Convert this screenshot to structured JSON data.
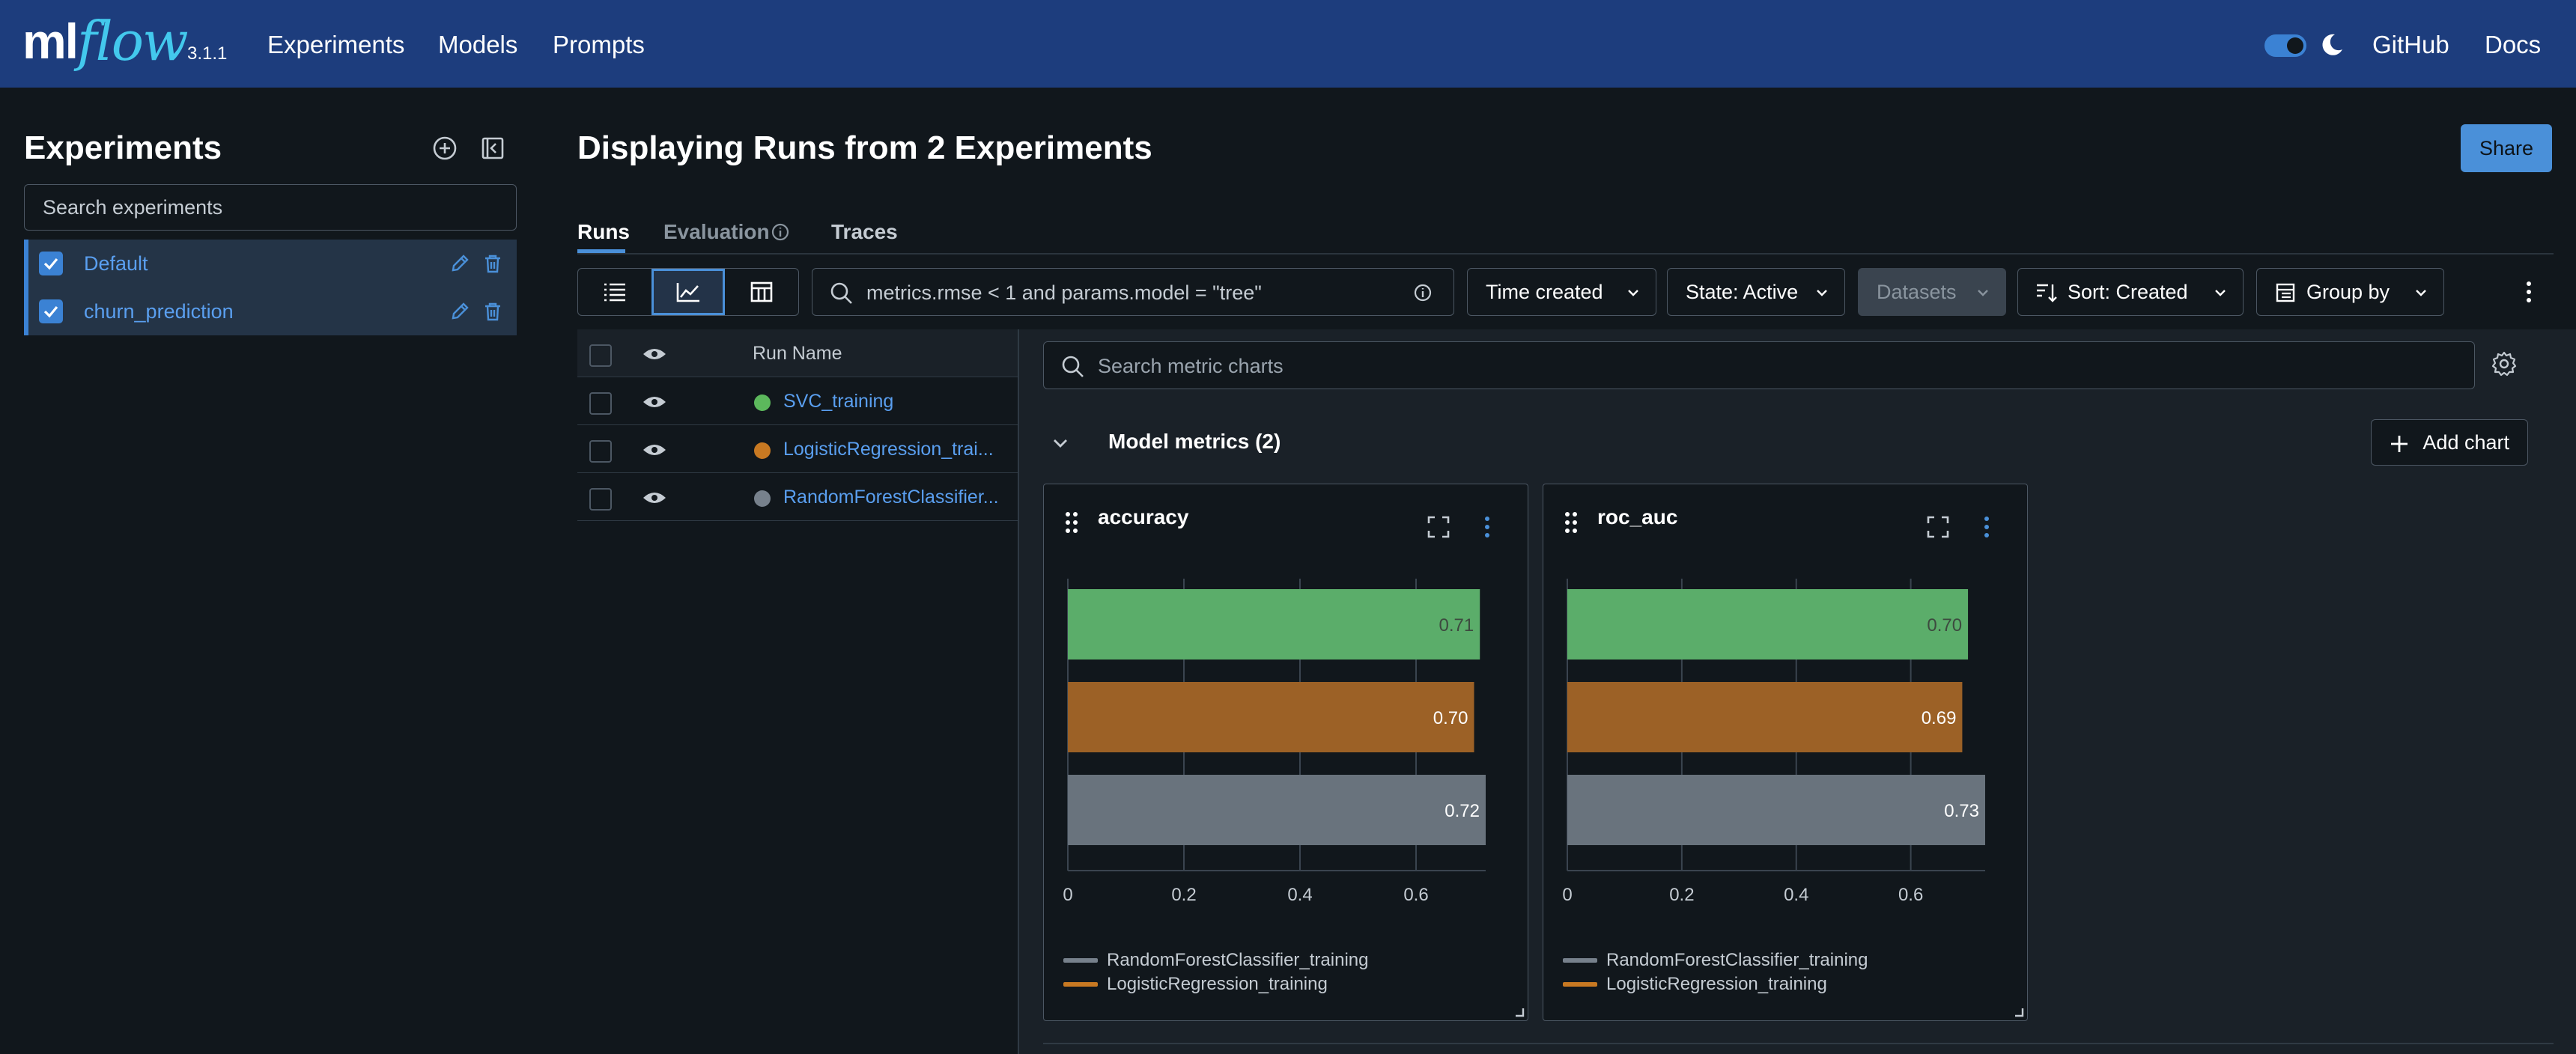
{
  "header": {
    "logo_ml": "ml",
    "logo_flow": "flow",
    "version": "3.1.1",
    "nav": [
      "Experiments",
      "Models",
      "Prompts"
    ],
    "right_links": [
      "GitHub",
      "Docs"
    ],
    "theme_toggle": "on",
    "colors": {
      "navbar": "#1d3d7d",
      "accent": "#43c9ed"
    }
  },
  "sidebar": {
    "title": "Experiments",
    "search_placeholder": "Search experiments",
    "items": [
      {
        "label": "Default",
        "checked": true
      },
      {
        "label": "churn_prediction",
        "checked": true
      }
    ]
  },
  "main": {
    "title": "Displaying Runs from 2 Experiments",
    "share_label": "Share",
    "tabs": [
      {
        "label": "Runs",
        "active": true
      },
      {
        "label": "Evaluation",
        "active": false
      },
      {
        "label": "Traces",
        "active": false
      }
    ],
    "filter_value": "metrics.rmse < 1 and params.model = \"tree\"",
    "dropdowns": {
      "time": "Time created",
      "state": "State: Active",
      "datasets": "Datasets",
      "sort": "Sort: Created",
      "group": "Group by"
    }
  },
  "runs": {
    "header": "Run Name",
    "rows": [
      {
        "name": "SVC_training",
        "color": "#5cb85c"
      },
      {
        "name": "LogisticRegression_trai...",
        "color": "#c87922"
      },
      {
        "name": "RandomForestClassifier...",
        "color": "#77818c"
      }
    ]
  },
  "charts": {
    "search_placeholder": "Search metric charts",
    "section_title": "Model metrics",
    "section_count": "(2)",
    "add_chart_label": "Add chart"
  },
  "chart_data": [
    {
      "type": "bar",
      "orientation": "horizontal",
      "title": "accuracy",
      "categories": [
        "SVC_training",
        "LogisticRegression_training",
        "RandomForestClassifier_training"
      ],
      "values": [
        0.71,
        0.7,
        0.72
      ],
      "labels": [
        "0.71",
        "0.70",
        "0.72"
      ],
      "colors": [
        "#5bad6a",
        "#9c6126",
        "#69737d"
      ],
      "xlim": [
        0,
        0.72
      ],
      "xticks": [
        0,
        0.2,
        0.4,
        0.6
      ],
      "xtick_labels": [
        "0",
        "0.2",
        "0.4",
        "0.6"
      ],
      "grid": true,
      "legend": [
        {
          "name": "RandomForestClassifier_training",
          "color": "#77818c"
        },
        {
          "name": "LogisticRegression_training",
          "color": "#c87922"
        }
      ]
    },
    {
      "type": "bar",
      "orientation": "horizontal",
      "title": "roc_auc",
      "categories": [
        "SVC_training",
        "LogisticRegression_training",
        "RandomForestClassifier_training"
      ],
      "values": [
        0.7,
        0.69,
        0.73
      ],
      "labels": [
        "0.70",
        "0.69",
        "0.73"
      ],
      "colors": [
        "#5bad6a",
        "#9c6126",
        "#69737d"
      ],
      "xlim": [
        0,
        0.73
      ],
      "xticks": [
        0,
        0.2,
        0.4,
        0.6
      ],
      "xtick_labels": [
        "0",
        "0.2",
        "0.4",
        "0.6"
      ],
      "grid": true,
      "legend": [
        {
          "name": "RandomForestClassifier_training",
          "color": "#77818c"
        },
        {
          "name": "LogisticRegression_training",
          "color": "#c87922"
        }
      ]
    }
  ]
}
